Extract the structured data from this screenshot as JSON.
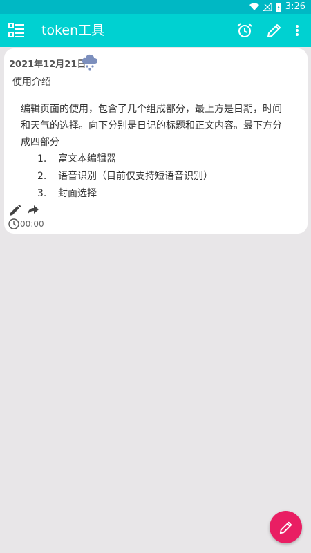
{
  "status_bar": {
    "time": "3:26"
  },
  "app_bar": {
    "title": "token工具"
  },
  "diary": {
    "date": "2021年12月21日",
    "weather_icon": "snow-cloud-icon",
    "title": "使用介绍",
    "paragraph": "编辑页面的使用，包含了几个组成部分，最上方是日期，时间和天气的选择。向下分别是日记的标题和正文内容。最下方分成四部分",
    "items": [
      {
        "num": "1.",
        "text": "富文本编辑器"
      },
      {
        "num": "2.",
        "text": "语音识别（目前仅支持短语音识别）"
      },
      {
        "num": "3.",
        "text": "封面选择"
      }
    ],
    "time": "00:00"
  },
  "colors": {
    "status_bar": "#00b8c4",
    "app_bar": "#00d1d1",
    "fab": "#e91e63",
    "background": "#e8e6e8"
  }
}
